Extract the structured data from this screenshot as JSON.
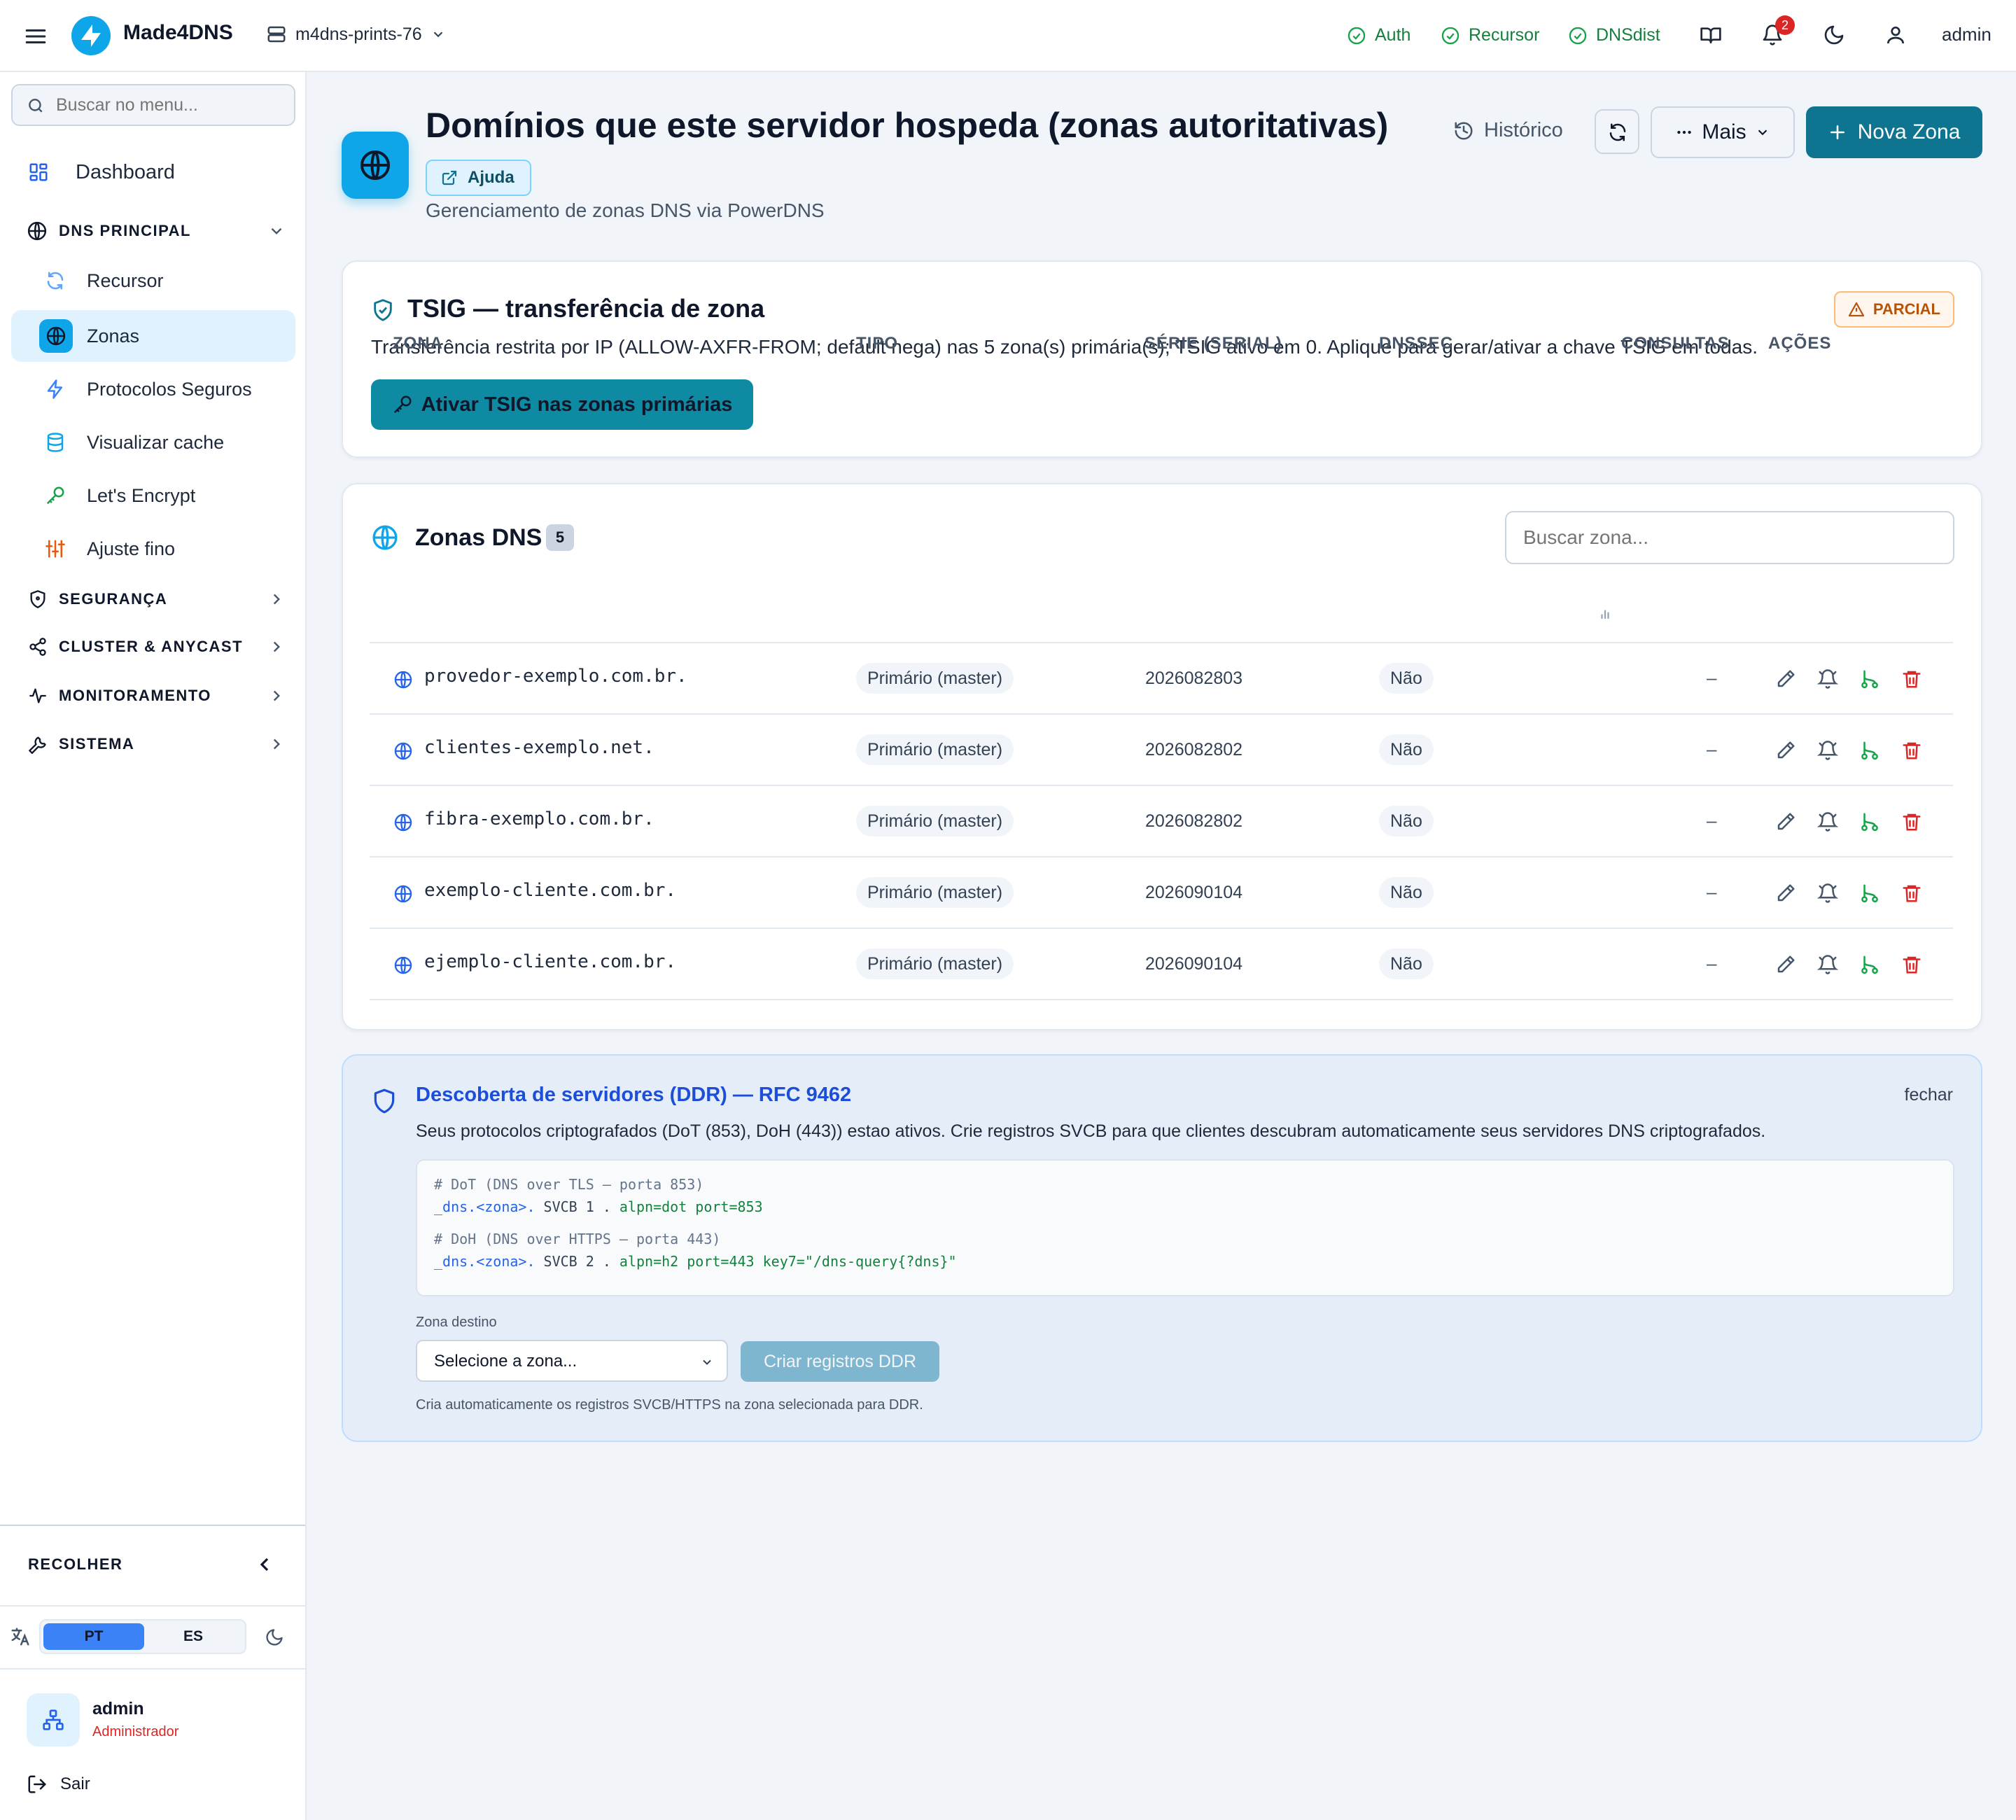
{
  "topbar": {
    "brand": "Made4DNS",
    "server": "m4dns-prints-76",
    "statuses": [
      "Auth",
      "Recursor",
      "DNSdist"
    ],
    "notification_count": "2",
    "user": "admin"
  },
  "sidebar": {
    "search_placeholder": "Buscar no menu...",
    "dashboard": "Dashboard",
    "dns_section": "DNS PRINCIPAL",
    "items": [
      "Recursor",
      "Zonas",
      "Protocolos Seguros",
      "Visualizar cache",
      "Let's Encrypt",
      "Ajuste fino"
    ],
    "sections": [
      "SEGURANÇA",
      "CLUSTER & ANYCAST",
      "MONITORAMENTO",
      "SISTEMA"
    ],
    "collapse": "RECOLHER",
    "lang": [
      "PT",
      "ES"
    ],
    "user_name": "admin",
    "user_role": "Administrador",
    "logout": "Sair"
  },
  "header": {
    "title": "Domínios que este servidor hospeda (zonas autoritativas)",
    "help": "Ajuda",
    "subtitle": "Gerenciamento de zonas DNS via PowerDNS",
    "history": "Histórico",
    "more": "Mais",
    "new_zone": "Nova Zona"
  },
  "tsig": {
    "title": "TSIG — transferência de zona",
    "badge": "PARCIAL",
    "description": "Transferência restrita por IP (ALLOW-AXFR-FROM; default nega) nas 5 zona(s) primária(s); TSIG ativo em 0. Aplique para gerar/ativar a chave TSIG em todas.",
    "button": "Ativar TSIG nas zonas primárias"
  },
  "zones": {
    "title": "Zonas DNS",
    "count": "5",
    "search_placeholder": "Buscar zona...",
    "columns": [
      "ZONA",
      "TIPO",
      "SÉRIE (SERIAL)",
      "DNSSEC",
      "CONSULTAS",
      "AÇÕES"
    ],
    "rows": [
      {
        "zone": "provedor-exemplo.com.br.",
        "type": "Primário (master)",
        "serial": "2026082803",
        "dnssec": "Não",
        "queries": "–"
      },
      {
        "zone": "clientes-exemplo.net.",
        "type": "Primário (master)",
        "serial": "2026082802",
        "dnssec": "Não",
        "queries": "–"
      },
      {
        "zone": "fibra-exemplo.com.br.",
        "type": "Primário (master)",
        "serial": "2026082802",
        "dnssec": "Não",
        "queries": "–"
      },
      {
        "zone": "exemplo-cliente.com.br.",
        "type": "Primário (master)",
        "serial": "2026090104",
        "dnssec": "Não",
        "queries": "–"
      },
      {
        "zone": "ejemplo-cliente.com.br.",
        "type": "Primário (master)",
        "serial": "2026090104",
        "dnssec": "Não",
        "queries": "–"
      }
    ]
  },
  "ddr": {
    "title": "Descoberta de servidores (DDR) — RFC 9462",
    "close": "fechar",
    "description": "Seus protocolos criptografados (DoT (853), DoH (443)) estao ativos. Crie registros SVCB para que clientes descubram automaticamente seus servidores DNS criptografados.",
    "code": {
      "dot_comment": "# DoT (DNS over TLS — porta 853)",
      "dot_name": "_dns.<zona>.",
      "dot_mid": " SVCB 1 . ",
      "dot_params": "alpn=dot port=853",
      "doh_comment": "# DoH (DNS over HTTPS — porta 443)",
      "doh_name": "_dns.<zona>.",
      "doh_mid": " SVCB 2 . ",
      "doh_params": "alpn=h2 port=443 key7=\"/dns-query{?dns}\""
    },
    "target_label": "Zona destino",
    "select_placeholder": "Selecione a zona...",
    "create_button": "Criar registros DDR",
    "hint": "Cria automaticamente os registros SVCB/HTTPS na zona selecionada para DDR."
  },
  "colors": {
    "primary": "#0e7490",
    "teal_button": "#0e8aa3",
    "success": "#15803d",
    "danger": "#dc2626",
    "warning": "#b45309",
    "ddr_blue": "#1d4ed8"
  }
}
